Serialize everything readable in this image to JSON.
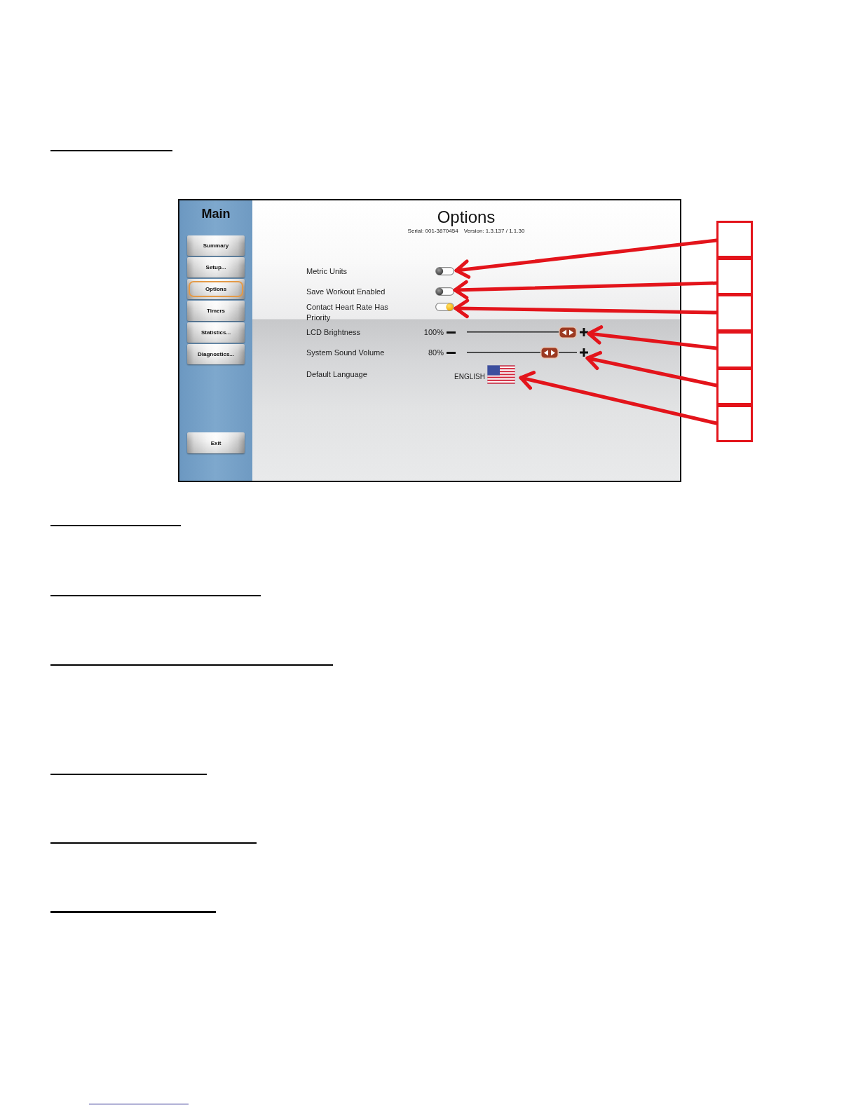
{
  "sidebar": {
    "title": "Main",
    "items": [
      {
        "label": "Summary",
        "selected": false
      },
      {
        "label": "Setup...",
        "selected": false
      },
      {
        "label": "Options",
        "selected": true
      },
      {
        "label": "Timers",
        "selected": false
      },
      {
        "label": "Statistics...",
        "selected": false
      },
      {
        "label": "Diagnostics...",
        "selected": false
      }
    ],
    "exit": "Exit"
  },
  "panel": {
    "title": "Options",
    "serial": "Serial: 001-3870454",
    "version": "Version: 1.3.137 / 1.1.30",
    "settings": [
      {
        "kind": "toggle",
        "label": "Metric Units",
        "on": false
      },
      {
        "kind": "toggle",
        "label": "Save Workout Enabled",
        "on": false
      },
      {
        "kind": "toggle",
        "label": "Contact Heart Rate Has Priority",
        "on": true
      },
      {
        "kind": "slider",
        "label": "LCD Brightness",
        "reading": "100%",
        "level": 1
      },
      {
        "kind": "slider",
        "label": "System Sound Volume",
        "reading": "80%",
        "level": 0.8
      },
      {
        "kind": "language",
        "label": "Default Language",
        "value": "ENGLISH"
      }
    ]
  }
}
